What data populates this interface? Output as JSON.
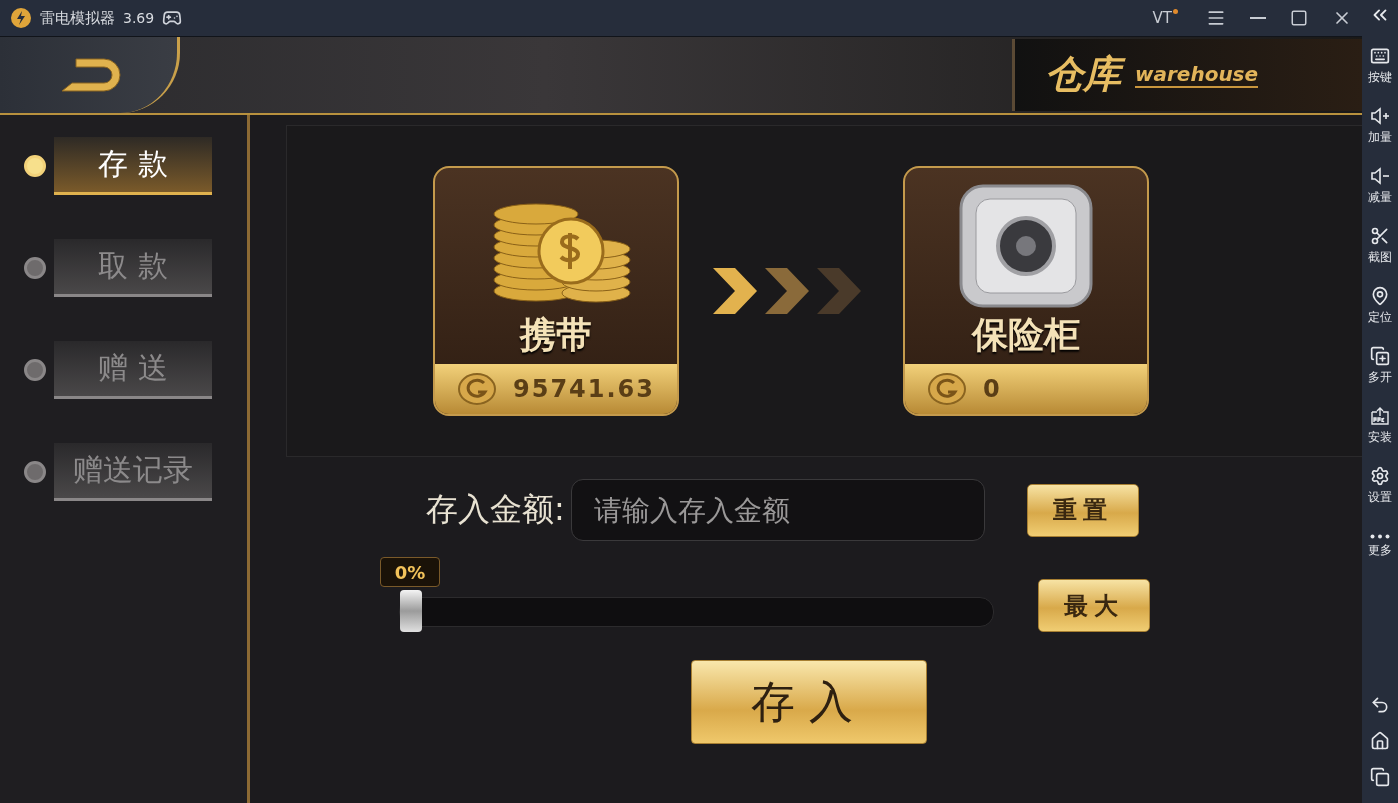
{
  "window": {
    "title": "雷电模拟器",
    "version": "3.69",
    "badge": "VT"
  },
  "header": {
    "title": "仓库",
    "subtitle": "warehouse"
  },
  "nav": [
    {
      "label": "存 款",
      "selected": true
    },
    {
      "label": "取 款",
      "selected": false
    },
    {
      "label": "赠 送",
      "selected": false
    },
    {
      "label": "赠送记录",
      "selected": false
    }
  ],
  "transfer": {
    "from": {
      "label": "携带",
      "amount": "95741.63"
    },
    "to": {
      "label": "保险柜",
      "amount": "0"
    }
  },
  "amount_field": {
    "label": "存入金额:",
    "placeholder": "请输入存入金额"
  },
  "reset_button": "重置",
  "slider": {
    "reading": "0%",
    "level": 0
  },
  "max_button": "最大",
  "submit_button": "存入",
  "toolbar": [
    {
      "label": "按键",
      "kind": "keyboard"
    },
    {
      "label": "加量",
      "kind": "louder"
    },
    {
      "label": "减量",
      "kind": "quieter"
    },
    {
      "label": "截图",
      "kind": "screenshot"
    },
    {
      "label": "定位",
      "kind": "location"
    },
    {
      "label": "多开",
      "kind": "multi"
    },
    {
      "label": "安装",
      "kind": "install"
    },
    {
      "label": "设置",
      "kind": "settings"
    },
    {
      "label": "更多",
      "kind": "more"
    }
  ]
}
